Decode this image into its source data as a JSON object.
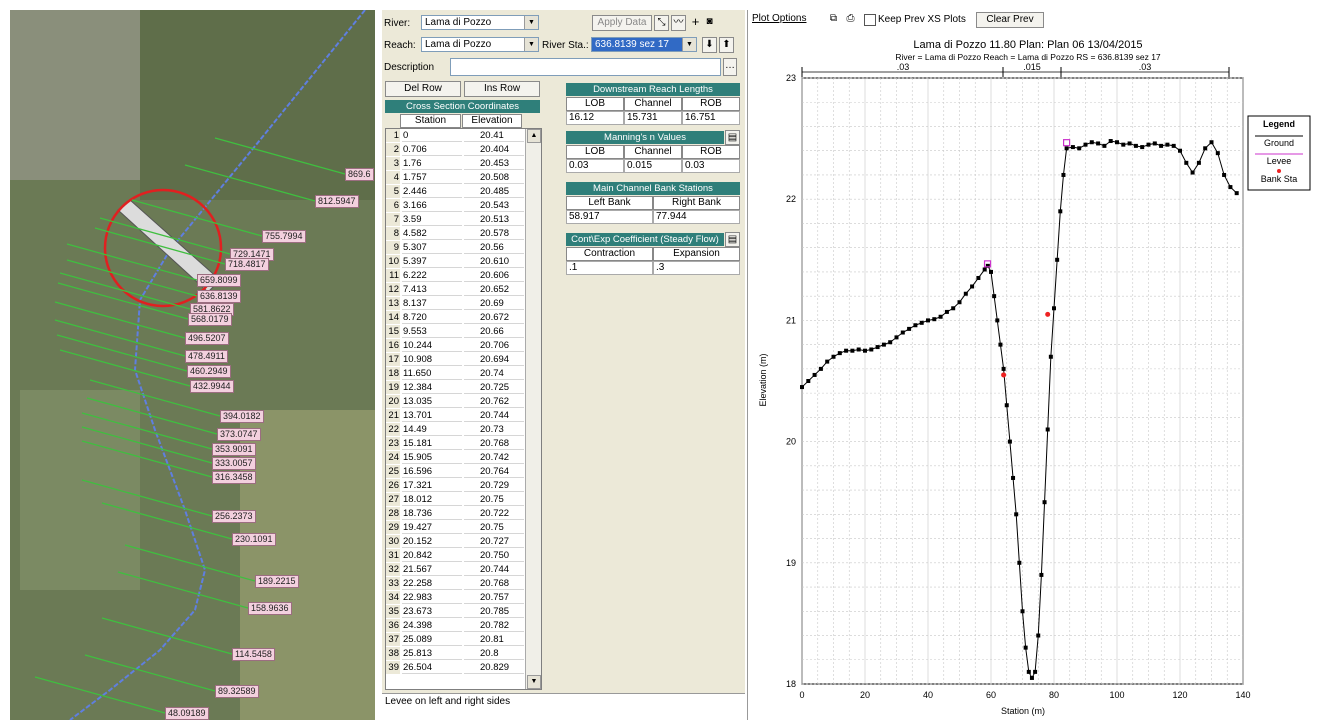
{
  "map": {
    "labels": [
      "869.6",
      "812.5947",
      "755.7994",
      "729.1471",
      "718.4817",
      "659.8099",
      "636.8139",
      "581.8622",
      "568.0179",
      "496.5207",
      "478.4911",
      "460.2949",
      "432.9944",
      "394.0182",
      "373.0747",
      "353.9091",
      "333.0057",
      "316.3458",
      "256.2373",
      "230.1091",
      "189.2215",
      "158.9636",
      "114.5458",
      "89.32589",
      "48.09189"
    ]
  },
  "editor": {
    "river_label": "River:",
    "river_value": "Lama di Pozzo",
    "reach_label": "Reach:",
    "reach_value": "Lama di Pozzo",
    "river_sta_label": "River Sta.:",
    "river_sta_value": "636.8139 sez 17",
    "apply_data": "Apply Data",
    "description_label": "Description",
    "del_row": "Del Row",
    "ins_row": "Ins Row",
    "xs_coords_title": "Cross Section Coordinates",
    "col_station": "Station",
    "col_elevation": "Elevation",
    "rows": [
      {
        "n": "1",
        "station": "0",
        "elev": "20.41"
      },
      {
        "n": "2",
        "station": "0.706",
        "elev": "20.404"
      },
      {
        "n": "3",
        "station": "1.76",
        "elev": "20.453"
      },
      {
        "n": "4",
        "station": "1.757",
        "elev": "20.508"
      },
      {
        "n": "5",
        "station": "2.446",
        "elev": "20.485"
      },
      {
        "n": "6",
        "station": "3.166",
        "elev": "20.543"
      },
      {
        "n": "7",
        "station": "3.59",
        "elev": "20.513"
      },
      {
        "n": "8",
        "station": "4.582",
        "elev": "20.578"
      },
      {
        "n": "9",
        "station": "5.307",
        "elev": "20.56"
      },
      {
        "n": "10",
        "station": "5.397",
        "elev": "20.610"
      },
      {
        "n": "11",
        "station": "6.222",
        "elev": "20.606"
      },
      {
        "n": "12",
        "station": "7.413",
        "elev": "20.652"
      },
      {
        "n": "13",
        "station": "8.137",
        "elev": "20.69"
      },
      {
        "n": "14",
        "station": "8.720",
        "elev": "20.672"
      },
      {
        "n": "15",
        "station": "9.553",
        "elev": "20.66"
      },
      {
        "n": "16",
        "station": "10.244",
        "elev": "20.706"
      },
      {
        "n": "17",
        "station": "10.908",
        "elev": "20.694"
      },
      {
        "n": "18",
        "station": "11.650",
        "elev": "20.74"
      },
      {
        "n": "19",
        "station": "12.384",
        "elev": "20.725"
      },
      {
        "n": "20",
        "station": "13.035",
        "elev": "20.762"
      },
      {
        "n": "21",
        "station": "13.701",
        "elev": "20.744"
      },
      {
        "n": "22",
        "station": "14.49",
        "elev": "20.73"
      },
      {
        "n": "23",
        "station": "15.181",
        "elev": "20.768"
      },
      {
        "n": "24",
        "station": "15.905",
        "elev": "20.742"
      },
      {
        "n": "25",
        "station": "16.596",
        "elev": "20.764"
      },
      {
        "n": "26",
        "station": "17.321",
        "elev": "20.729"
      },
      {
        "n": "27",
        "station": "18.012",
        "elev": "20.75"
      },
      {
        "n": "28",
        "station": "18.736",
        "elev": "20.722"
      },
      {
        "n": "29",
        "station": "19.427",
        "elev": "20.75"
      },
      {
        "n": "30",
        "station": "20.152",
        "elev": "20.727"
      },
      {
        "n": "31",
        "station": "20.842",
        "elev": "20.750"
      },
      {
        "n": "32",
        "station": "21.567",
        "elev": "20.744"
      },
      {
        "n": "33",
        "station": "22.258",
        "elev": "20.768"
      },
      {
        "n": "34",
        "station": "22.983",
        "elev": "20.757"
      },
      {
        "n": "35",
        "station": "23.673",
        "elev": "20.785"
      },
      {
        "n": "36",
        "station": "24.398",
        "elev": "20.782"
      },
      {
        "n": "37",
        "station": "25.089",
        "elev": "20.81"
      },
      {
        "n": "38",
        "station": "25.813",
        "elev": "20.8"
      },
      {
        "n": "39",
        "station": "26.504",
        "elev": "20.829"
      }
    ],
    "downstream_title": "Downstream Reach Lengths",
    "lob_label": "LOB",
    "channel_label": "Channel",
    "rob_label": "ROB",
    "ds_lob": "16.12",
    "ds_channel": "15.731",
    "ds_rob": "16.751",
    "manning_title": "Manning's n Values",
    "n_lob": "0.03",
    "n_channel": "0.015",
    "n_rob": "0.03",
    "bank_title": "Main Channel Bank Stations",
    "left_bank_label": "Left Bank",
    "right_bank_label": "Right Bank",
    "left_bank": "58.917",
    "right_bank": "77.944",
    "coef_title": "Cont\\Exp Coefficient (Steady Flow)",
    "contraction_label": "Contraction",
    "expansion_label": "Expansion",
    "contraction": ".1",
    "expansion": ".3",
    "status": "Levee on left and right sides"
  },
  "plot": {
    "plot_options": "Plot Options",
    "keep_prev": "Keep Prev XS Plots",
    "clear_prev": "Clear Prev",
    "title": "Lama di Pozzo 11.80      Plan: Plan 06      13/04/2015",
    "subtitle": "River = Lama di Pozzo   Reach = Lama di Pozzo      RS = 636.8139   sez 17",
    "n_zone_left": ".03",
    "n_zone_mid": ".015",
    "n_zone_right": ".03",
    "legend_title": "Legend",
    "legend_ground": "Ground",
    "legend_levee": "Levee",
    "legend_bank": "Bank Sta"
  },
  "chart_data": {
    "type": "line",
    "xlabel": "Station (m)",
    "ylabel": "Elevation (m)",
    "xlim": [
      0,
      140
    ],
    "ylim": [
      18,
      23
    ],
    "xticks": [
      0,
      20,
      40,
      60,
      80,
      100,
      120,
      140
    ],
    "yticks": [
      18,
      19,
      20,
      21,
      22,
      23
    ],
    "grid": true,
    "legend": "right",
    "series": [
      {
        "name": "Ground",
        "color": "#000000",
        "x": [
          0,
          2,
          4,
          6,
          8,
          10,
          12,
          14,
          16,
          18,
          20,
          22,
          24,
          26,
          28,
          30,
          32,
          34,
          36,
          38,
          40,
          42,
          44,
          46,
          48,
          50,
          52,
          54,
          56,
          58,
          59,
          60,
          61,
          62,
          63,
          64,
          65,
          66,
          67,
          68,
          69,
          70,
          71,
          72,
          73,
          74,
          75,
          76,
          77,
          78,
          79,
          80,
          81,
          82,
          83,
          84,
          86,
          88,
          90,
          92,
          94,
          96,
          98,
          100,
          102,
          104,
          106,
          108,
          110,
          112,
          114,
          116,
          118,
          120,
          122,
          124,
          126,
          128,
          130,
          132,
          134,
          136,
          138
        ],
        "y": [
          20.45,
          20.5,
          20.55,
          20.6,
          20.66,
          20.7,
          20.73,
          20.75,
          20.75,
          20.76,
          20.75,
          20.76,
          20.78,
          20.8,
          20.82,
          20.86,
          20.9,
          20.93,
          20.96,
          20.98,
          21.0,
          21.01,
          21.03,
          21.07,
          21.1,
          21.15,
          21.22,
          21.28,
          21.35,
          21.42,
          21.45,
          21.4,
          21.2,
          21.0,
          20.8,
          20.6,
          20.3,
          20.0,
          19.7,
          19.4,
          19.0,
          18.6,
          18.3,
          18.1,
          18.05,
          18.1,
          18.4,
          18.9,
          19.5,
          20.1,
          20.7,
          21.1,
          21.5,
          21.9,
          22.2,
          22.42,
          22.43,
          22.42,
          22.45,
          22.47,
          22.46,
          22.44,
          22.48,
          22.47,
          22.45,
          22.46,
          22.44,
          22.43,
          22.45,
          22.46,
          22.44,
          22.45,
          22.44,
          22.4,
          22.3,
          22.22,
          22.3,
          22.42,
          22.47,
          22.38,
          22.2,
          22.1,
          22.05
        ]
      },
      {
        "name": "Levee",
        "color": "#cc33cc",
        "x": [
          58.9,
          84
        ],
        "y": [
          21.45,
          22.45
        ]
      },
      {
        "name": "Bank Sta",
        "color": "#ee2222",
        "x": [
          64,
          78
        ],
        "y": [
          20.55,
          21.05
        ]
      }
    ]
  }
}
